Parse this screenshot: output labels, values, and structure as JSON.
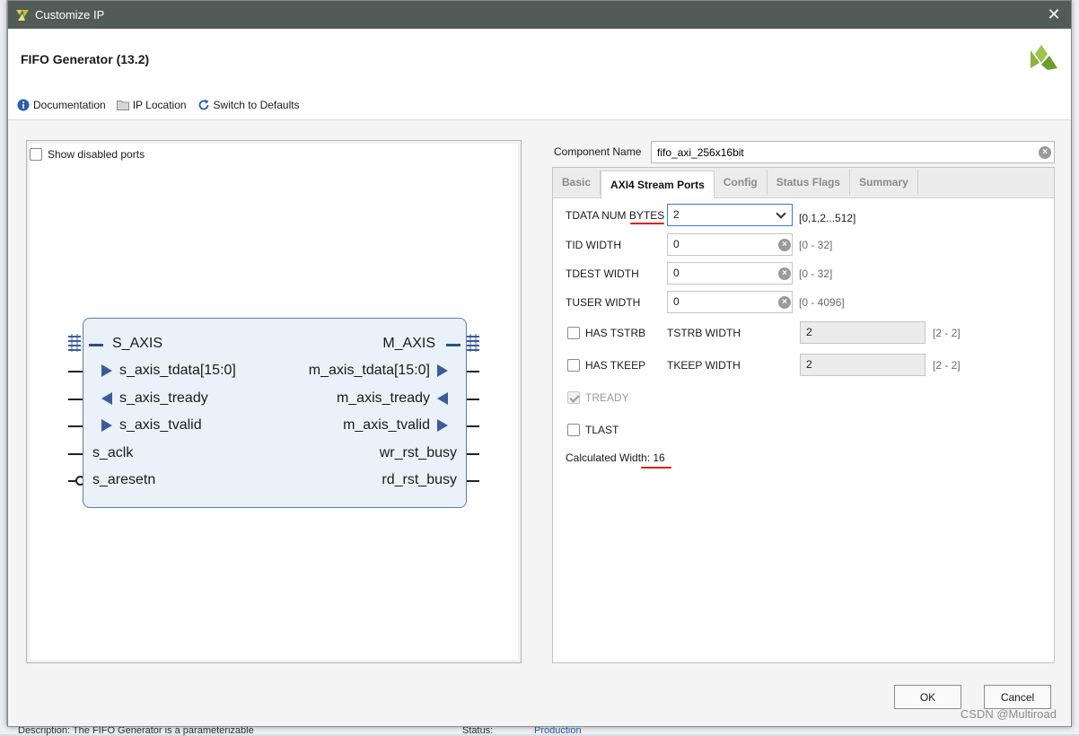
{
  "window": {
    "title": "Customize IP",
    "close_glyph": "✕"
  },
  "header": {
    "ip_title": "FIFO Generator (13.2)"
  },
  "toolbar": {
    "documentation": "Documentation",
    "ip_location": "IP Location",
    "switch_defaults": "Switch to Defaults"
  },
  "left": {
    "show_disabled_ports": "Show disabled ports",
    "block": {
      "s_bus": "S_AXIS",
      "m_bus": "M_AXIS",
      "left_pins": [
        "s_axis_tdata[15:0]",
        "s_axis_tready",
        "s_axis_tvalid",
        "s_aclk",
        "s_aresetn"
      ],
      "right_pins": [
        "m_axis_tdata[15:0]",
        "m_axis_tready",
        "m_axis_tvalid",
        "wr_rst_busy",
        "rd_rst_busy"
      ]
    }
  },
  "right": {
    "component_name_label": "Component Name",
    "component_name_value": "fifo_axi_256x16bit",
    "tabs": [
      "Basic",
      "AXI4 Stream Ports",
      "Config",
      "Status Flags",
      "Summary"
    ],
    "active_tab": "AXI4 Stream Ports",
    "fields": {
      "tdata_num_bytes": {
        "label": "TDATA NUM BYTES",
        "value": "2",
        "range": "[0,1,2...512]"
      },
      "tid_width": {
        "label": "TID WIDTH",
        "value": "0",
        "range": "[0 - 32]"
      },
      "tdest_width": {
        "label": "TDEST WIDTH",
        "value": "0",
        "range": "[0 - 32]"
      },
      "tuser_width": {
        "label": "TUSER WIDTH",
        "value": "0",
        "range": "[0 - 4096]"
      }
    },
    "has_tstrb": {
      "label": "HAS TSTRB",
      "checked": false,
      "width_label": "TSTRB WIDTH",
      "width_value": "2",
      "range": "[2 - 2]"
    },
    "has_tkeep": {
      "label": "HAS TKEEP",
      "checked": false,
      "width_label": "TKEEP WIDTH",
      "width_value": "2",
      "range": "[2 - 2]"
    },
    "tready": {
      "label": "TREADY",
      "checked": true,
      "disabled": true
    },
    "tlast": {
      "label": "TLAST",
      "checked": false
    },
    "calculated_width": "Calculated Width: 16"
  },
  "buttons": {
    "ok": "OK",
    "cancel": "Cancel"
  },
  "watermark": "CSDN @Multiroad",
  "background": {
    "bottom_left": "Description:   The FIFO Generator is a parameterizable",
    "status_label": "Status:",
    "status_value": "Production"
  },
  "colors": {
    "titlebar": "#535b58",
    "accent": "#3c7ad6",
    "block_border": "#5a7fae",
    "block_fill": "#eaf1f9",
    "annotation_red": "#e02020"
  }
}
